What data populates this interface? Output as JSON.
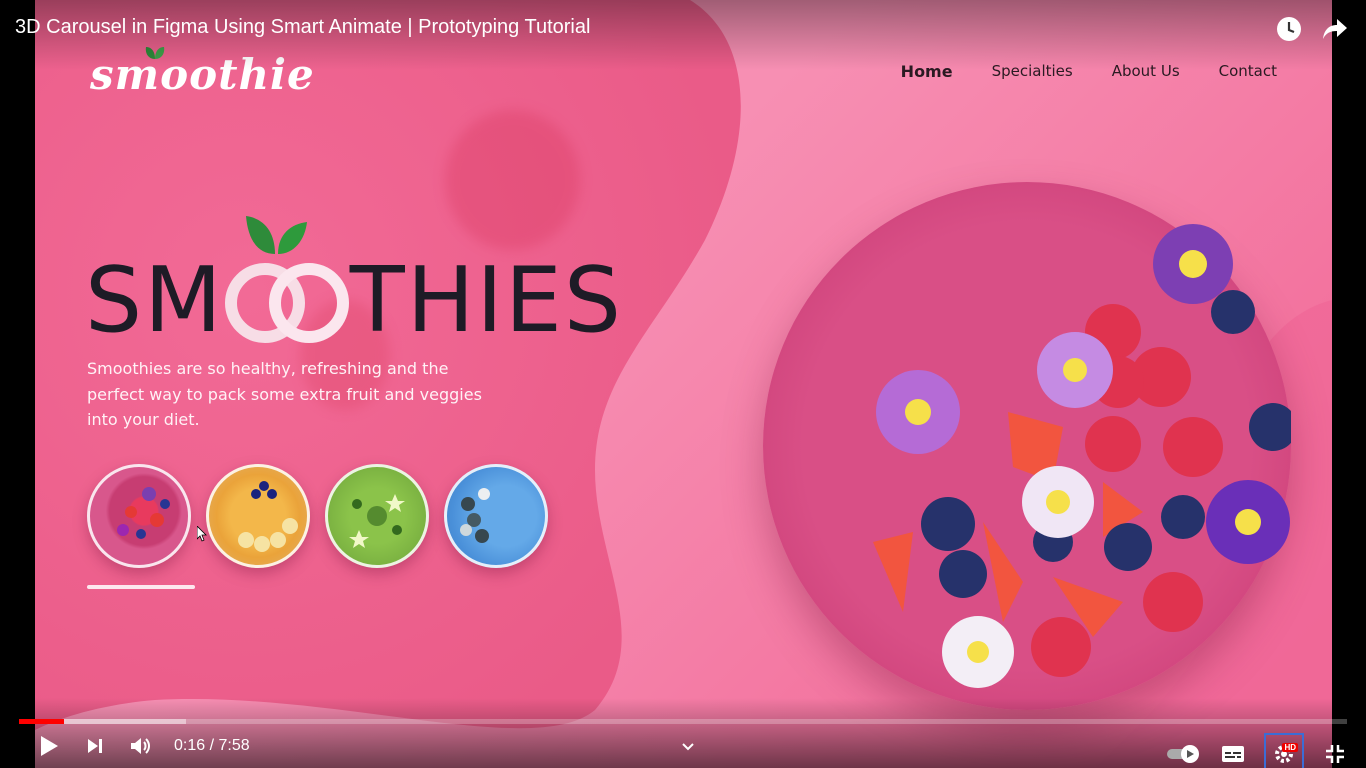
{
  "video": {
    "title": "3D Carousel in Figma Using Smart Animate | Prototyping Tutorial",
    "current_time": "0:16",
    "duration": "7:58",
    "time_separator": " / ",
    "played_fraction": 0.034,
    "loaded_fraction": 0.126,
    "hd_badge": "HD"
  },
  "site": {
    "logo": "smoothie",
    "nav": [
      {
        "label": "Home",
        "active": true
      },
      {
        "label": "Specialties",
        "active": false
      },
      {
        "label": "About Us",
        "active": false
      },
      {
        "label": "Contact",
        "active": false
      }
    ],
    "hero_title_left": "SM",
    "hero_title_right": "THIES",
    "hero_description": "Smoothies are so healthy, refreshing and the perfect way to pack some extra fruit and veggies into your diet.",
    "thumbnails": [
      "berry-bowl",
      "banana-bowl",
      "green-bowl",
      "blue-bowl"
    ],
    "selected_thumbnail_index": 0
  },
  "colors": {
    "brand_pink": "#f06292",
    "title_dark": "#1e1b26",
    "leaf_green": "#2e8b3a",
    "progress_red": "#ff0000"
  },
  "icons": {
    "watch_later": "clock-icon",
    "share": "share-arrow-icon",
    "play": "play-icon",
    "next": "next-icon",
    "volume": "volume-icon",
    "autoplay": "autoplay-toggle-icon",
    "subtitles": "subtitles-icon",
    "settings": "gear-icon",
    "exit_fullscreen": "exit-fullscreen-icon"
  }
}
